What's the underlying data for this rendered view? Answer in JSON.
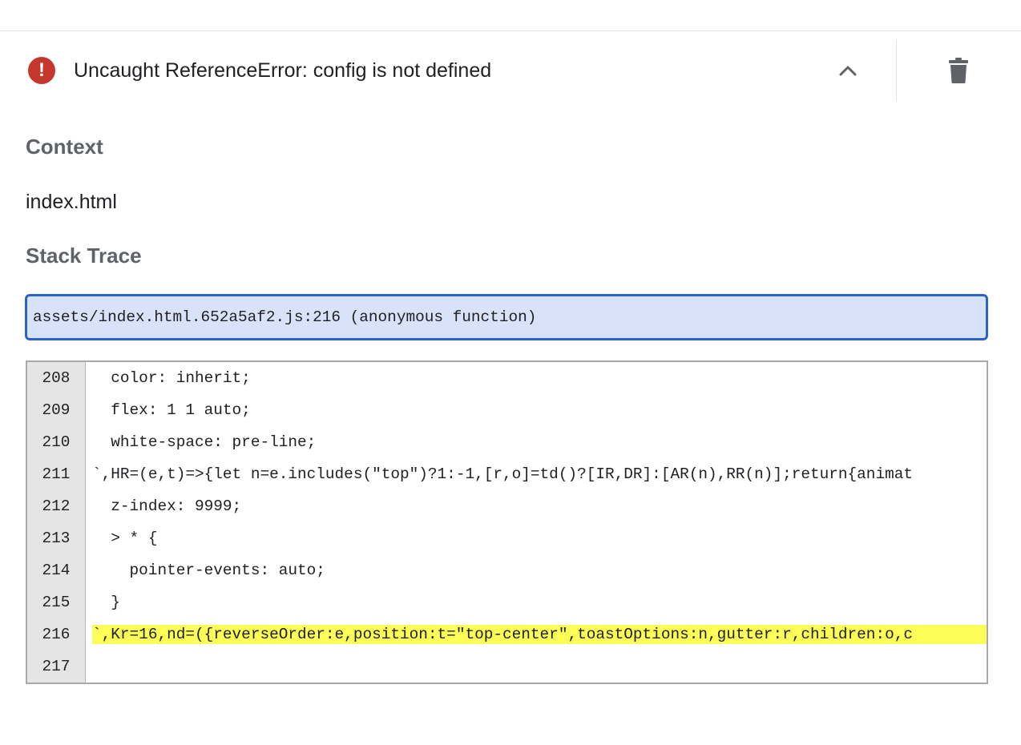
{
  "error": {
    "icon": "exclamation-circle-icon",
    "icon_glyph": "!",
    "message": "Uncaught ReferenceError: config is not defined",
    "collapse_icon": "chevron-up-icon",
    "delete_icon": "trash-icon",
    "color": "#c5372c"
  },
  "context": {
    "heading": "Context",
    "value": "index.html"
  },
  "stack_trace": {
    "heading": "Stack Trace",
    "selected_frame": "assets/index.html.652a5af2.js:216 (anonymous function)",
    "highlight_color": "#fdfd57",
    "lines": [
      {
        "number": "208",
        "code": "  color: inherit;"
      },
      {
        "number": "209",
        "code": "  flex: 1 1 auto;"
      },
      {
        "number": "210",
        "code": "  white-space: pre-line;"
      },
      {
        "number": "211",
        "code": "`,HR=(e,t)=>{let n=e.includes(\"top\")?1:-1,[r,o]=td()?[IR,DR]:[AR(n),RR(n)];return{animat"
      },
      {
        "number": "212",
        "code": "  z-index: 9999;"
      },
      {
        "number": "213",
        "code": "  > * {"
      },
      {
        "number": "214",
        "code": "    pointer-events: auto;"
      },
      {
        "number": "215",
        "code": "  }"
      },
      {
        "number": "216",
        "code": "`,Kr=16,nd=({reverseOrder:e,position:t=\"top-center\",toastOptions:n,gutter:r,children:o,c",
        "highlighted": true
      },
      {
        "number": "217",
        "code": ""
      }
    ]
  }
}
